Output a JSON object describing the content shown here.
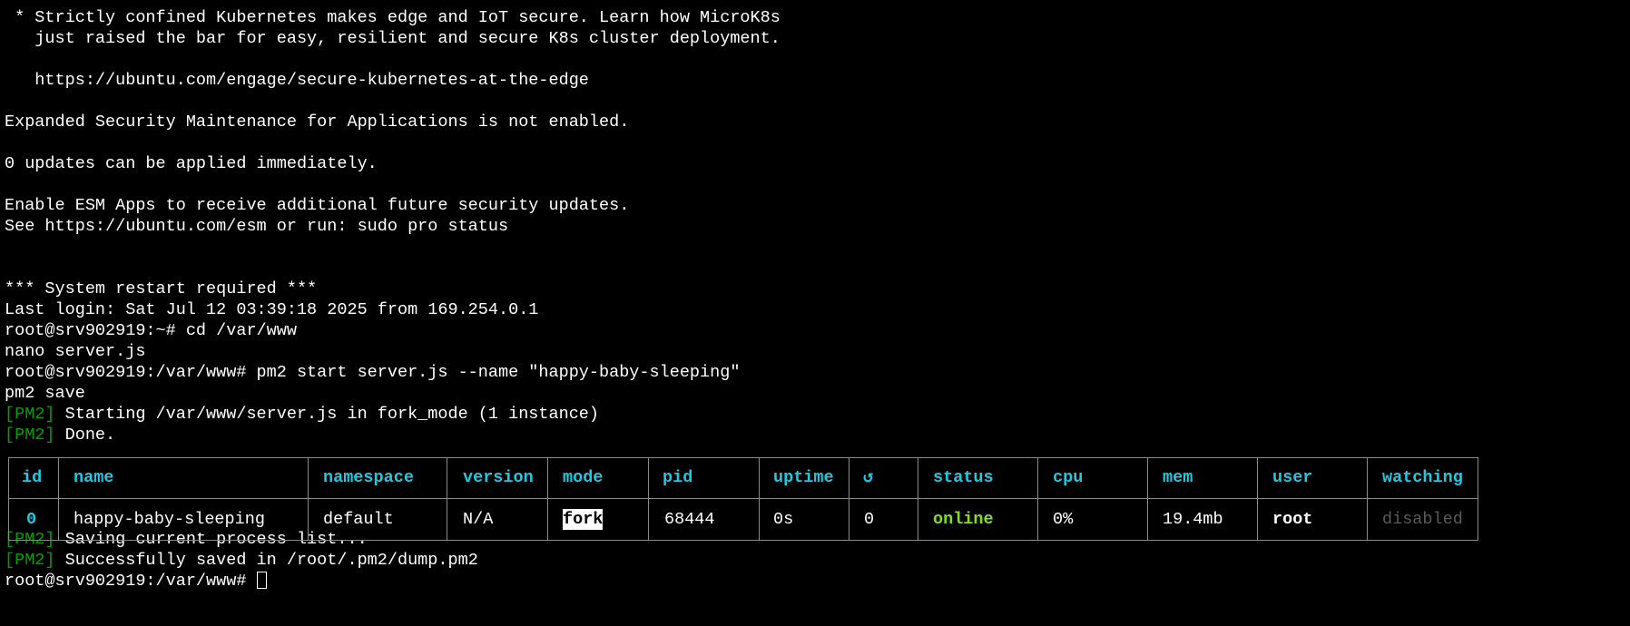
{
  "terminal": {
    "motd": [
      " * Strictly confined Kubernetes makes edge and IoT secure. Learn how MicroK8s",
      "   just raised the bar for easy, resilient and secure K8s cluster deployment.",
      "",
      "   https://ubuntu.com/engage/secure-kubernetes-at-the-edge",
      "",
      "Expanded Security Maintenance for Applications is not enabled.",
      "",
      "0 updates can be applied immediately.",
      "",
      "Enable ESM Apps to receive additional future security updates.",
      "See https://ubuntu.com/esm or run: sudo pro status",
      "",
      "",
      "*** System restart required ***",
      "Last login: Sat Jul 12 03:39:18 2025 from 169.254.0.1",
      "root@srv902919:~# cd /var/www",
      "nano server.js",
      "root@srv902919:/var/www# pm2 start server.js --name \"happy-baby-sleeping\"",
      "pm2 save"
    ],
    "pm2_tag": "[PM2]",
    "start_msgs": [
      " Starting /var/www/server.js in fork_mode (1 instance)",
      " Done."
    ],
    "save_msgs": [
      " Saving current process list...",
      " Successfully saved in /root/.pm2/dump.pm2"
    ],
    "prompt": "root@srv902919:/var/www# "
  },
  "pm2_table": {
    "headers": {
      "id": "id",
      "name": "name",
      "namespace": "namespace",
      "version": "version",
      "mode": "mode",
      "pid": "pid",
      "uptime": "uptime",
      "restarts": "↺",
      "status": "status",
      "cpu": "cpu",
      "mem": "mem",
      "user": "user",
      "watching": "watching"
    },
    "row": {
      "id": "0",
      "name": "happy-baby-sleeping",
      "namespace": "default",
      "version": "N/A",
      "mode": "fork",
      "pid": "68444",
      "uptime": "0s",
      "restarts": "0",
      "status": "online",
      "cpu": "0%",
      "mem": "19.4mb",
      "user": "root",
      "watching": "disabled"
    }
  },
  "colors": {
    "background": "#000000",
    "text": "#ffffff",
    "pm2_tag": "#00a000",
    "header": "#1fc9e0",
    "status_online": "#80e020",
    "watching_disabled": "#5a5a5a"
  }
}
